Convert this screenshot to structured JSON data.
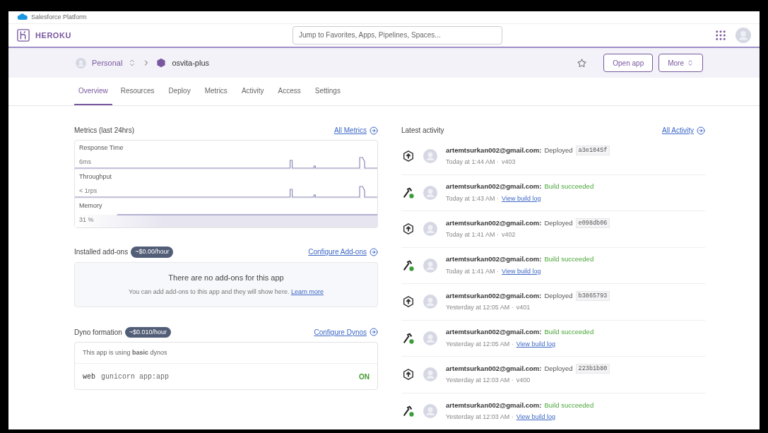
{
  "platform_bar": {
    "label": "Salesforce Platform"
  },
  "header": {
    "logo_text": "HEROKU",
    "search": {
      "placeholder": "Jump to Favorites, Apps, Pipelines, Spaces..."
    }
  },
  "app_header": {
    "breadcrumb": [
      {
        "label": "Personal",
        "kind": "team"
      },
      {
        "label": "osvita-plus",
        "kind": "app"
      }
    ],
    "favorite": false,
    "buttons": [
      {
        "label": "Open app",
        "dropdown": false
      },
      {
        "label": "More",
        "dropdown": true
      }
    ]
  },
  "tabs": [
    {
      "label": "Overview",
      "selected": true
    },
    {
      "label": "Resources",
      "selected": false
    },
    {
      "label": "Deploy",
      "selected": false
    },
    {
      "label": "Metrics",
      "selected": false
    },
    {
      "label": "Activity",
      "selected": false
    },
    {
      "label": "Access",
      "selected": false
    },
    {
      "label": "Settings",
      "selected": false
    }
  ],
  "metrics": {
    "title": "Metrics (last 24hrs)",
    "link": "All Metrics",
    "items": [
      {
        "name": "Response Time",
        "value": "6ms",
        "kind": "spikes"
      },
      {
        "name": "Throughput",
        "value": "< 1rps",
        "kind": "spikes"
      },
      {
        "name": "Memory",
        "value": "31 %",
        "kind": "band"
      }
    ]
  },
  "addons": {
    "title": "Installed add-ons",
    "price": "~$0.00/hour",
    "link": "Configure Add-ons",
    "empty_title": "There are no add-ons for this app",
    "empty_text": "You can add add-ons to this app and they will show here.",
    "empty_link": "Learn more"
  },
  "dynos": {
    "title": "Dyno formation",
    "price": "~$0.010/hour",
    "link": "Configure Dynos",
    "note": "This app is using **basic** dynos",
    "rows": [
      {
        "type": "web",
        "command": "gunicorn app:app",
        "on": true,
        "status": "ON"
      }
    ]
  },
  "activity": {
    "title": "Latest activity",
    "link": "All Activity",
    "items": [
      {
        "kind": "deploy",
        "user": "artemtsurkan002@gmail.com:",
        "action": "Deployed",
        "commit": "a3e1045f",
        "time": "Today at 1:44 AM ·",
        "version": "v403"
      },
      {
        "kind": "build",
        "user": "artemtsurkan002@gmail.com:",
        "action": "Build succeeded",
        "time": "Today at 1:43 AM ·",
        "link": "View build log"
      },
      {
        "kind": "deploy",
        "user": "artemtsurkan002@gmail.com:",
        "action": "Deployed",
        "commit": "e098db06",
        "time": "Today at 1:41 AM ·",
        "version": "v402"
      },
      {
        "kind": "build",
        "user": "artemtsurkan002@gmail.com:",
        "action": "Build succeeded",
        "time": "Today at 1:41 AM ·",
        "link": "View build log"
      },
      {
        "kind": "deploy",
        "user": "artemtsurkan002@gmail.com:",
        "action": "Deployed",
        "commit": "b3865793",
        "time": "Yesterday at 12:05 AM ·",
        "version": "v401"
      },
      {
        "kind": "build",
        "user": "artemtsurkan002@gmail.com:",
        "action": "Build succeeded",
        "time": "Yesterday at 12:05 AM ·",
        "link": "View build log"
      },
      {
        "kind": "deploy",
        "user": "artemtsurkan002@gmail.com:",
        "action": "Deployed",
        "commit": "223b1b80",
        "time": "Yesterday at 12:03 AM ·",
        "version": "v400"
      },
      {
        "kind": "build",
        "user": "artemtsurkan002@gmail.com:",
        "action": "Build succeeded",
        "time": "Yesterday at 12:03 AM ·",
        "link": "View build log"
      }
    ]
  }
}
